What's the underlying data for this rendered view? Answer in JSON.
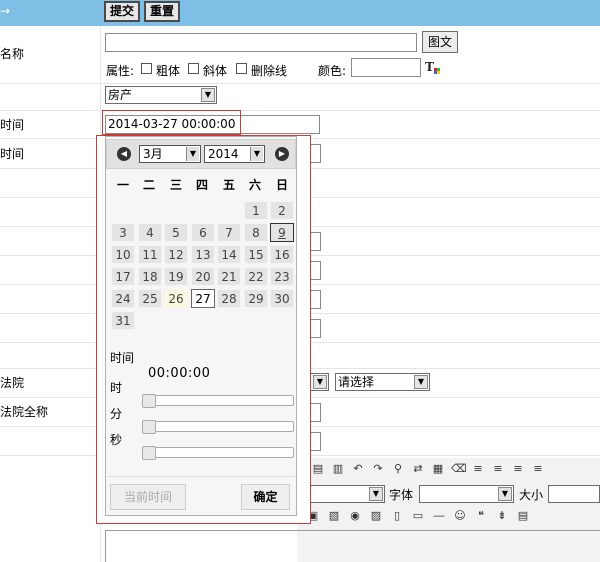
{
  "topbar": {
    "arrow": "→",
    "submit": "提交",
    "reset": "重置"
  },
  "labels": {
    "name": "名称",
    "time1": "时间",
    "time2": "时间",
    "court": "法院",
    "court_full": "法院全称"
  },
  "name_row": {
    "image_button": "图文",
    "attr_label": "属性:",
    "bold": "粗体",
    "italic": "斜体",
    "strike": "删除线",
    "color_label": "颜色:"
  },
  "category_select": "房产",
  "datetime_value": "2014-03-27 00:00:00",
  "court_select": {
    "placeholder": "请选择"
  },
  "calendar": {
    "month": "3月",
    "year": "2014",
    "weekdays": [
      "一",
      "二",
      "三",
      "四",
      "五",
      "六",
      "日"
    ],
    "rows": [
      [
        "",
        "",
        "",
        "",
        "",
        "1",
        "2"
      ],
      [
        "3",
        "4",
        "5",
        "6",
        "7",
        "8",
        "9"
      ],
      [
        "10",
        "11",
        "12",
        "13",
        "14",
        "15",
        "16"
      ],
      [
        "17",
        "18",
        "19",
        "20",
        "21",
        "22",
        "23"
      ],
      [
        "24",
        "25",
        "26",
        "27",
        "28",
        "29",
        "30"
      ],
      [
        "31",
        "",
        "",
        "",
        "",
        "",
        ""
      ]
    ],
    "today": "26",
    "selected": "27",
    "hover": "9",
    "time_label": "时间",
    "time_value": "00:00:00",
    "hour_label": "时",
    "minute_label": "分",
    "second_label": "秒",
    "now_button": "当前时间",
    "ok_button": "确定"
  },
  "editor": {
    "font_label": "字体",
    "size_label": "大小"
  }
}
